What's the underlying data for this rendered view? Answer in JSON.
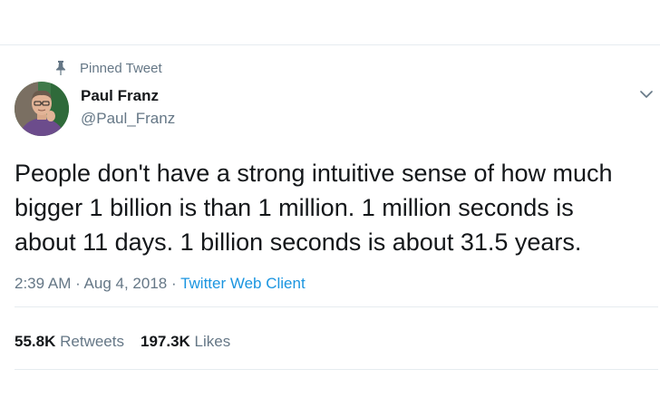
{
  "pinned": {
    "label": "Pinned Tweet",
    "icon": "pin-icon"
  },
  "author": {
    "name": "Paul Franz",
    "handle": "@Paul_Franz",
    "avatar_icon": "avatar"
  },
  "menu": {
    "icon": "chevron-down-icon"
  },
  "tweet": {
    "text": "People don't have a strong intuitive sense of how much\nbigger 1 billion is than 1 million. 1 million seconds is\nabout 11 days. 1 billion seconds is about 31.5 years."
  },
  "meta": {
    "time": "2:39 AM",
    "separator": " · ",
    "date": "Aug 4, 2018",
    "source": "Twitter Web Client"
  },
  "stats": {
    "retweets_count": "55.8K",
    "retweets_label": "Retweets",
    "likes_count": "197.3K",
    "likes_label": "Likes"
  },
  "colors": {
    "text": "#14171a",
    "secondary": "#657786",
    "link": "#1b95e0",
    "divider": "#e6ecf0"
  }
}
